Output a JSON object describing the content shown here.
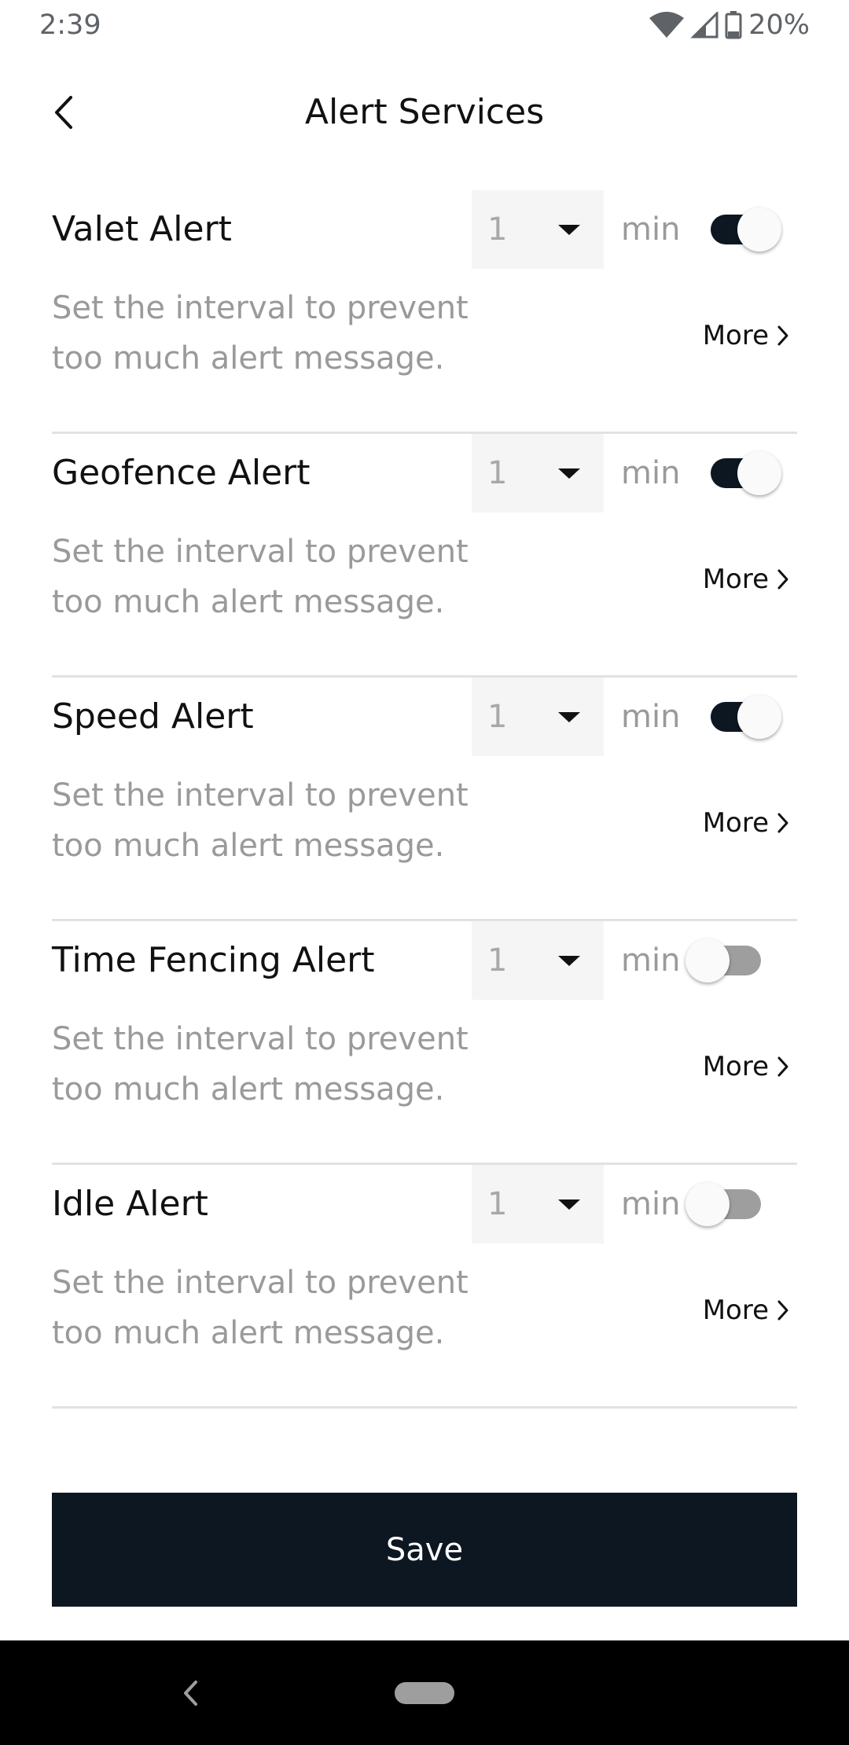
{
  "status_bar": {
    "time": "2:39",
    "battery": "20%",
    "icons": [
      "wifi-icon",
      "cell-signal-icon",
      "battery-icon"
    ]
  },
  "header": {
    "title": "Alert Services",
    "back_icon": "back-chevron-icon"
  },
  "alerts": [
    {
      "name": "Valet Alert",
      "interval": "1",
      "unit": "min",
      "enabled": true,
      "description": "Set the interval to prevent too much alert message.",
      "more_label": "More"
    },
    {
      "name": "Geofence Alert",
      "interval": "1",
      "unit": "min",
      "enabled": true,
      "description": "Set the interval to prevent too much alert message.",
      "more_label": "More"
    },
    {
      "name": "Speed Alert",
      "interval": "1",
      "unit": "min",
      "enabled": true,
      "description": "Set the interval to prevent too much alert message.",
      "more_label": "More"
    },
    {
      "name": "Time Fencing Alert",
      "interval": "1",
      "unit": "min",
      "enabled": false,
      "description": "Set the interval to prevent too much alert message.",
      "more_label": "More"
    },
    {
      "name": "Idle Alert",
      "interval": "1",
      "unit": "min",
      "enabled": false,
      "description": "Set the interval to prevent too much alert message.",
      "more_label": "More"
    }
  ],
  "save_button": {
    "label": "Save"
  },
  "colors": {
    "primary": "#0c1722",
    "muted_text": "#9a9a9a",
    "divider": "#e2e2e2",
    "select_bg": "#f5f5f5"
  }
}
